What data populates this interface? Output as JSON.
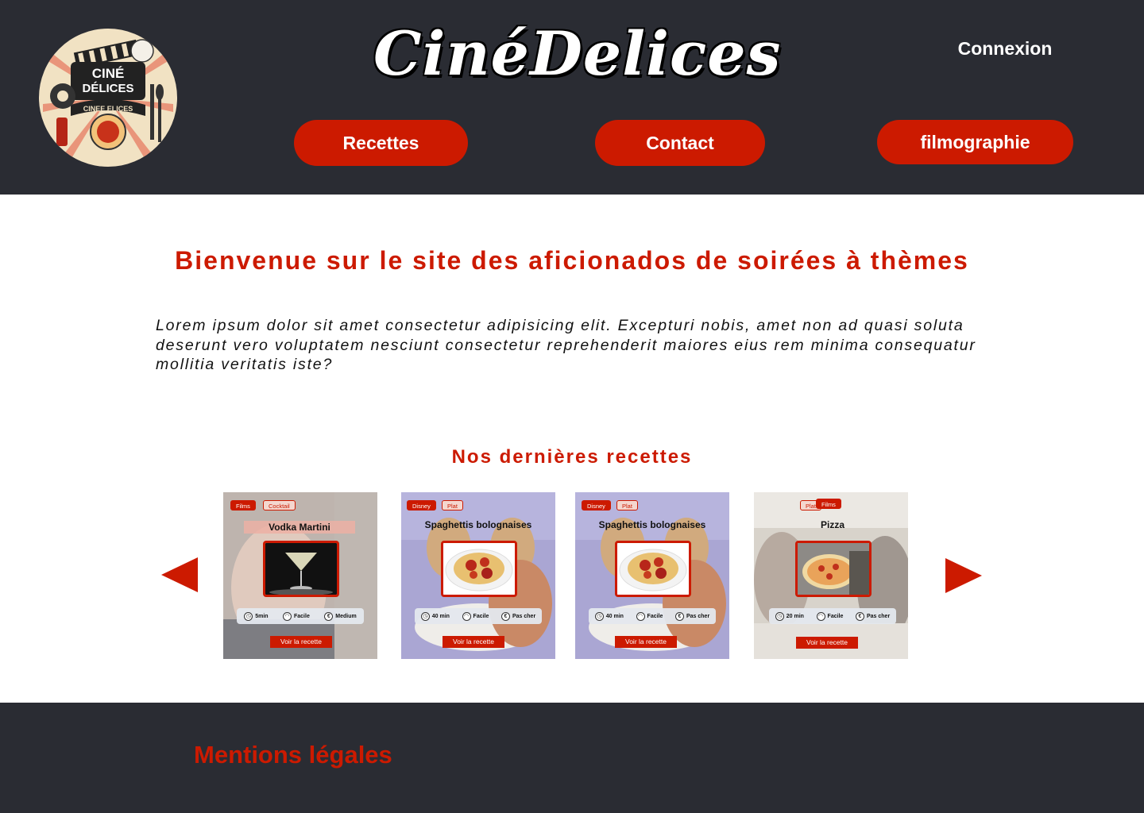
{
  "header": {
    "brand": "CinéDelices",
    "login_label": "Connexion",
    "nav": {
      "recettes": "Recettes",
      "contact": "Contact",
      "filmographie": "filmographie"
    },
    "logo": {
      "line1": "CINÉ",
      "line2": "DÉLICES",
      "ribbon": "CINEE ELICES"
    }
  },
  "main": {
    "welcome_title": "Bienvenue sur le site des aficionados de soirées à thèmes",
    "intro_text": "Lorem ipsum dolor sit amet consectetur adipisicing elit. Excepturi nobis, amet non ad quasi soluta deserunt vero voluptatem nesciunt consectetur reprehenderit maiores eius rem minima consequatur mollitia veritatis iste?",
    "latest_title": "Nos dernières recettes",
    "prev_icon": "triangle-left-icon",
    "next_icon": "triangle-right-icon",
    "cards": [
      {
        "tags": [
          "Films",
          "Cocktail"
        ],
        "title": "Vodka Martini",
        "time": "5min",
        "difficulty": "Facile",
        "cost": "Medium",
        "button": "Voir la recette"
      },
      {
        "tags": [
          "Disney",
          "Plat"
        ],
        "title": "Spaghettis bolognaises",
        "time": "40 min",
        "difficulty": "Facile",
        "cost": "Pas cher",
        "button": "Voir la recette"
      },
      {
        "tags": [
          "Disney",
          "Plat"
        ],
        "title": "Spaghettis bolognaises",
        "time": "40 min",
        "difficulty": "Facile",
        "cost": "Pas cher",
        "button": "Voir la recette"
      },
      {
        "tags": [
          "Plat",
          "Films"
        ],
        "title": "Pizza",
        "time": "20 min",
        "difficulty": "Facile",
        "cost": "Pas cher",
        "button": "Voir la recette"
      }
    ]
  },
  "footer": {
    "legal_label": "Mentions légales"
  },
  "colors": {
    "dark": "#2a2c33",
    "accent": "#cc1a00",
    "white": "#ffffff"
  }
}
